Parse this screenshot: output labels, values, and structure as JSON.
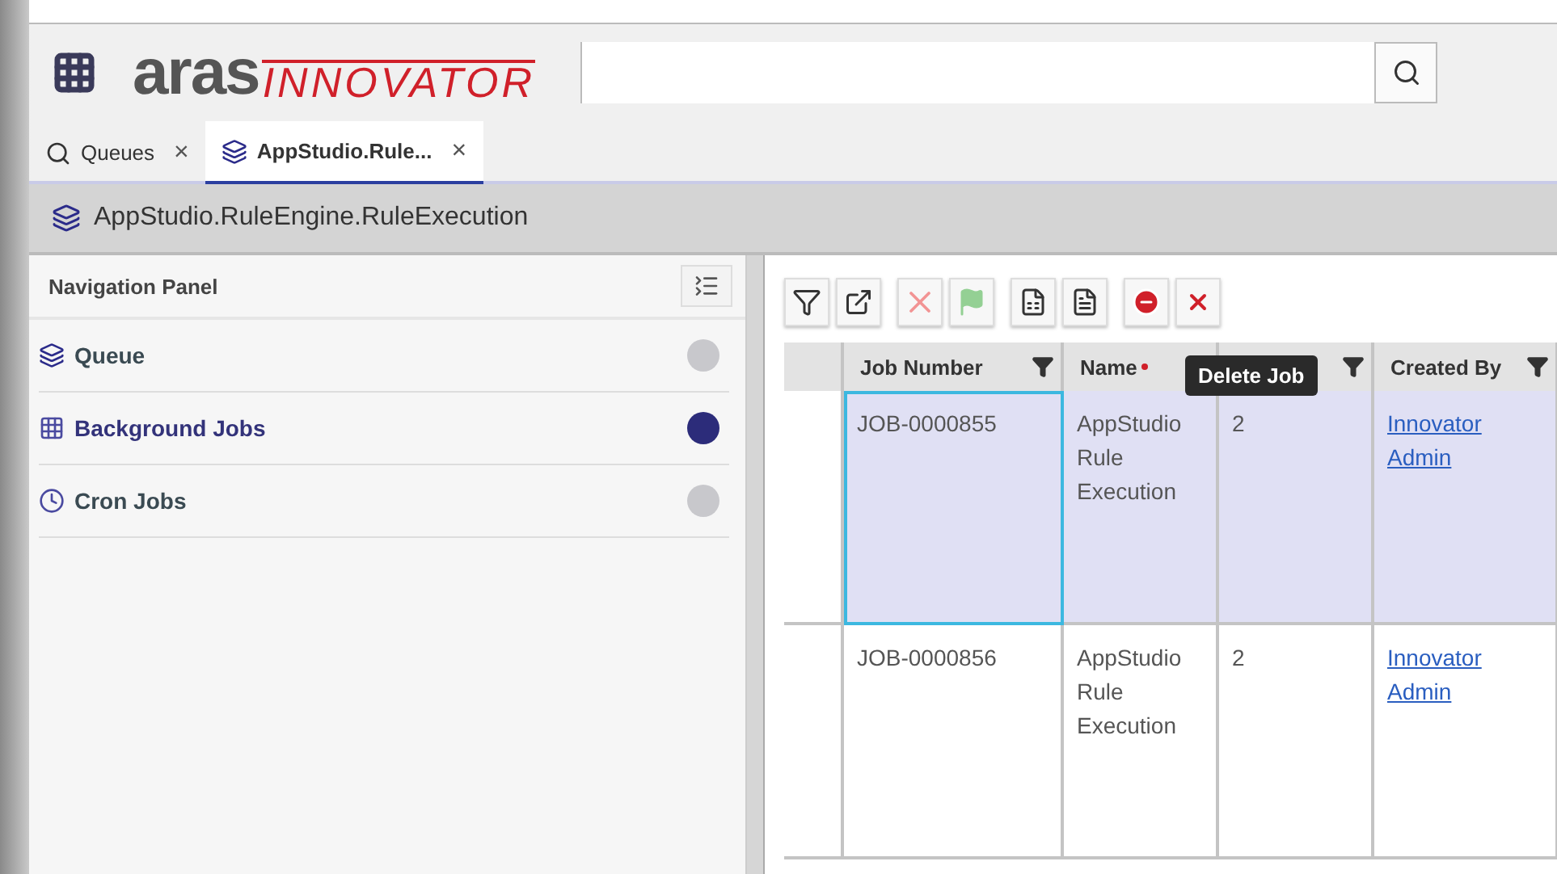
{
  "header": {
    "logo_main": "aras",
    "logo_sub": "INNOVATOR"
  },
  "tabs": [
    {
      "label": "Queues",
      "selected": false,
      "close": "×"
    },
    {
      "label": "AppStudio.Rule...",
      "selected": true,
      "close": "×"
    }
  ],
  "title_bar": {
    "title": "AppStudio.RuleEngine.RuleExecution"
  },
  "navigation_panel": {
    "title": "Navigation Panel",
    "items": [
      {
        "label": "Queue",
        "selected": false
      },
      {
        "label": "Background Jobs",
        "selected": true
      },
      {
        "label": "Cron Jobs",
        "selected": false
      }
    ]
  },
  "toolbar": {
    "buttons": [
      {
        "kind": "filter",
        "disabled": false
      },
      {
        "kind": "open",
        "disabled": false
      },
      {
        "kind": "delete",
        "disabled": true
      },
      {
        "kind": "flag",
        "disabled": true
      },
      {
        "kind": "excel",
        "disabled": false
      },
      {
        "kind": "pdf",
        "disabled": false
      },
      {
        "kind": "stop",
        "disabled": false
      },
      {
        "kind": "cancel",
        "disabled": false
      }
    ],
    "tooltip": "Delete Job"
  },
  "table": {
    "columns": [
      {
        "label": "Job Number",
        "required": false
      },
      {
        "label": "Name",
        "required": true
      },
      {
        "required": false
      },
      {
        "label": "Created By",
        "required": false
      }
    ],
    "rows": [
      {
        "selected": true,
        "cells": [
          "JOB-0000855",
          "AppStudio Rule Execution",
          "2",
          "Innovator Admin"
        ]
      },
      {
        "selected": false,
        "cells": [
          "JOB-0000856",
          "AppStudio Rule Execution",
          "2",
          "Innovator Admin"
        ]
      }
    ]
  }
}
